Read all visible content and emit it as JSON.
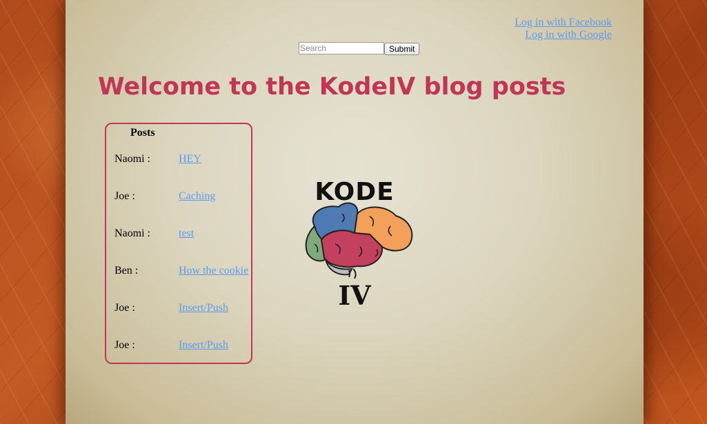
{
  "login": {
    "facebook_label": "Log in with Facebook",
    "google_label": "Log in with Google"
  },
  "search": {
    "placeholder": "Search",
    "value": "",
    "submit_label": "Submit"
  },
  "page_title": "Welcome to the KodeIV blog posts",
  "posts": {
    "heading": "Posts",
    "items": [
      {
        "author": "Naomi :",
        "title": "HEY"
      },
      {
        "author": "Joe :",
        "title": "Caching"
      },
      {
        "author": "Naomi :",
        "title": "test"
      },
      {
        "author": "Ben :",
        "title": "How the cookie"
      },
      {
        "author": "Joe :",
        "title": "Insert/Push"
      },
      {
        "author": "Joe :",
        "title": "Insert/Push"
      }
    ]
  },
  "logo": {
    "top_text": "KODE",
    "bottom_text": "IV",
    "icon": "brain-logo"
  },
  "colors": {
    "title": "#c03756",
    "link": "#5b9cf0",
    "frame": "#b04a1c",
    "paper": "#dcd6bf"
  }
}
